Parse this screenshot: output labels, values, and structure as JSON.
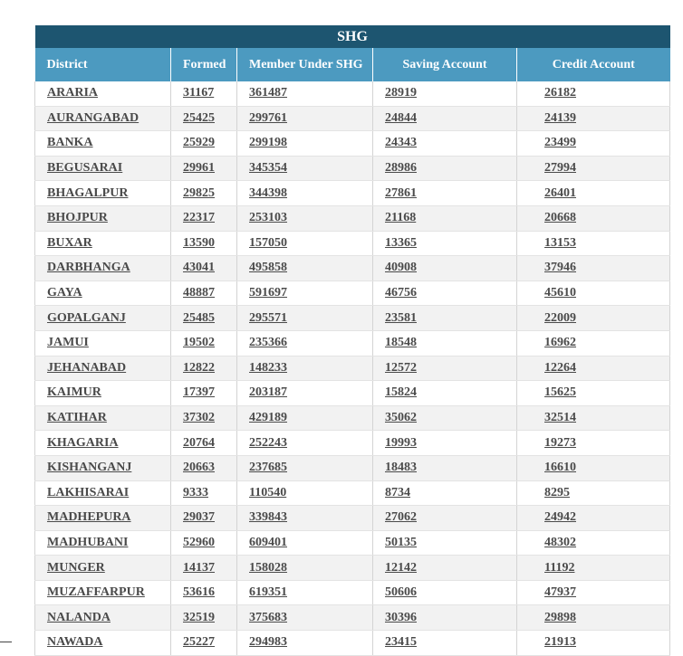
{
  "table": {
    "title": "SHG",
    "headers": [
      "District",
      "Formed",
      "Member Under SHG",
      "Saving Account",
      "Credit Account"
    ],
    "rows": [
      [
        "ARARIA",
        "31167",
        "361487",
        "28919",
        "26182"
      ],
      [
        "AURANGABAD",
        "25425",
        "299761",
        "24844",
        "24139"
      ],
      [
        "BANKA",
        "25929",
        "299198",
        "24343",
        "23499"
      ],
      [
        "BEGUSARAI",
        "29961",
        "345354",
        "28986",
        "27994"
      ],
      [
        "BHAGALPUR",
        "29825",
        "344398",
        "27861",
        "26401"
      ],
      [
        "BHOJPUR",
        "22317",
        "253103",
        "21168",
        "20668"
      ],
      [
        "BUXAR",
        "13590",
        "157050",
        "13365",
        "13153"
      ],
      [
        "DARBHANGA",
        "43041",
        "495858",
        "40908",
        "37946"
      ],
      [
        "GAYA",
        "48887",
        "591697",
        "46756",
        "45610"
      ],
      [
        "GOPALGANJ",
        "25485",
        "295571",
        "23581",
        "22009"
      ],
      [
        "JAMUI",
        "19502",
        "235366",
        "18548",
        "16962"
      ],
      [
        "JEHANABAD",
        "12822",
        "148233",
        "12572",
        "12264"
      ],
      [
        "KAIMUR",
        "17397",
        "203187",
        "15824",
        "15625"
      ],
      [
        "KATIHAR",
        "37302",
        "429189",
        "35062",
        "32514"
      ],
      [
        "KHAGARIA",
        "20764",
        "252243",
        "19993",
        "19273"
      ],
      [
        "KISHANGANJ",
        "20663",
        "237685",
        "18483",
        "16610"
      ],
      [
        "LAKHISARAI",
        "9333",
        "110540",
        "8734",
        "8295"
      ],
      [
        "MADHEPURA",
        "29037",
        "339843",
        "27062",
        "24942"
      ],
      [
        "MADHUBANI",
        "52960",
        "609401",
        "50135",
        "48302"
      ],
      [
        "MUNGER",
        "14137",
        "158028",
        "12142",
        "11192"
      ],
      [
        "MUZAFFARPUR",
        "53616",
        "619351",
        "50606",
        "47937"
      ],
      [
        "NALANDA",
        "32519",
        "375683",
        "30396",
        "29898"
      ],
      [
        "NAWADA",
        "25227",
        "294983",
        "23415",
        "21913"
      ]
    ]
  },
  "colors": {
    "title_bg": "#1d5570",
    "header_bg": "#4c9ac0",
    "link": "#4a4a4a"
  }
}
